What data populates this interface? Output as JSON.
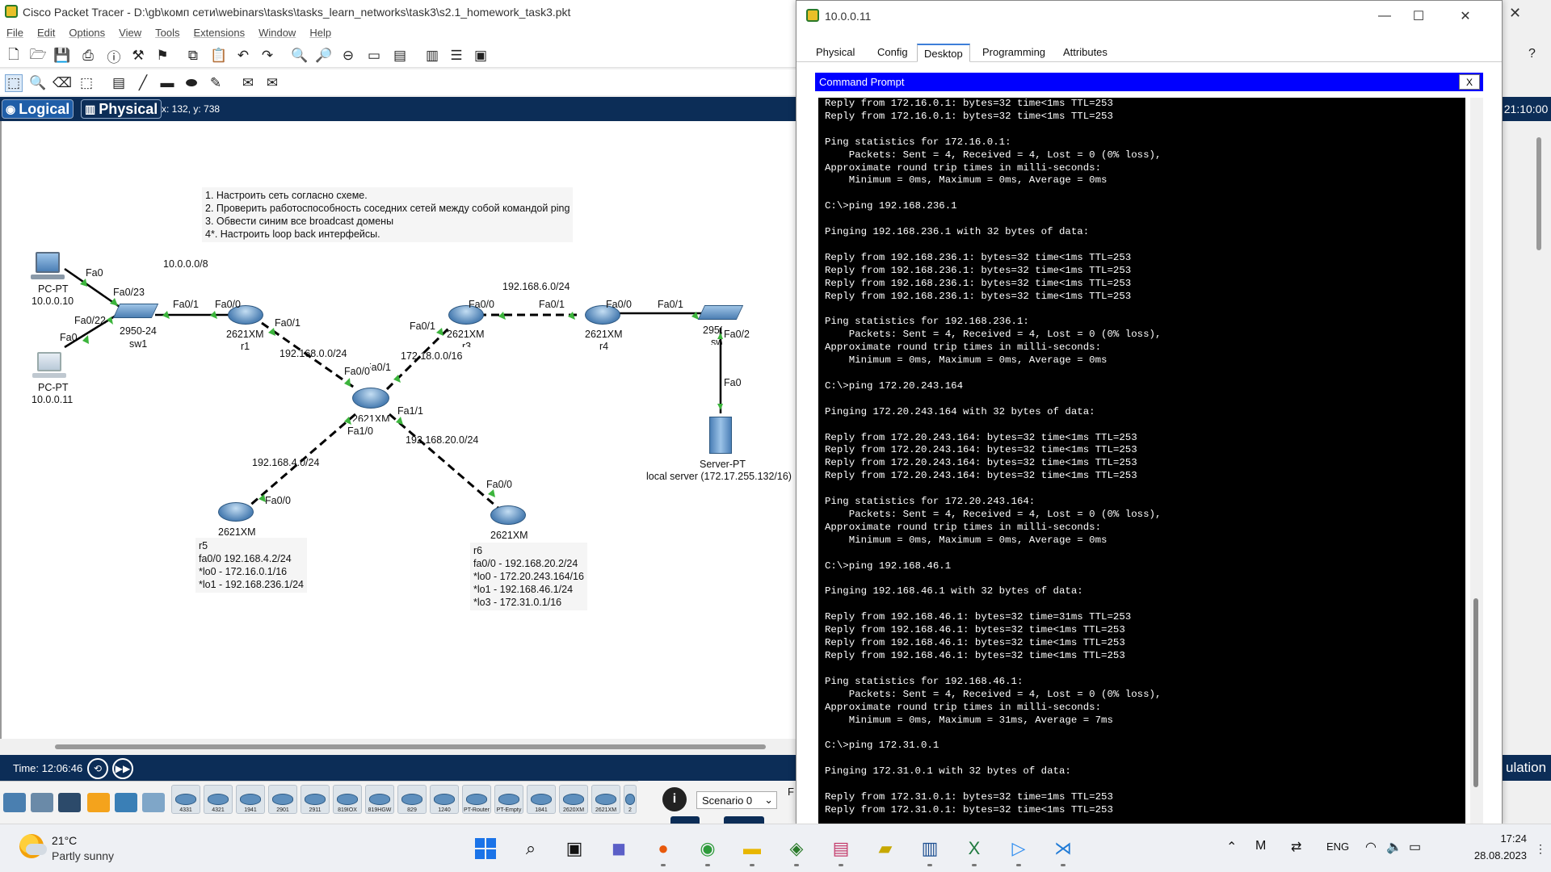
{
  "app": {
    "title": "Cisco Packet Tracer - D:\\gb\\комп сети\\webinars\\tasks\\tasks_learn_networks\\task3\\s2.1_homework_task3.pkt",
    "menu": [
      "File",
      "Edit",
      "Options",
      "View",
      "Tools",
      "Extensions",
      "Window",
      "Help"
    ],
    "view_logical": "Logical",
    "view_physical": "Physical",
    "coords": "x: 132, y: 738",
    "clock_right": "21:10:00",
    "sim_label": "ulation",
    "time_label": "Time: 12:06:46",
    "scenario": "Scenario 0",
    "scenario_frag": "F"
  },
  "notes": {
    "task": [
      "1. Настроить сеть согласно схеме.",
      "2. Проверить работоспособность соседних сетей между собой командой ping",
      "3. Обвести синим все broadcast домены",
      "4*. Настроить loop back интерфейсы."
    ],
    "r5": [
      "r5",
      "fa0/0 192.168.4.2/24",
      "*lo0 - 172.16.0.1/16",
      "*lo1 - 192.168.236.1/24"
    ],
    "r6": [
      "r6",
      "fa0/0 - 192.168.20.2/24",
      "*lo0 - 172.20.243.164/16",
      "*lo1 - 192.168.46.1/24",
      "*lo3 - 172.31.0.1/16"
    ]
  },
  "topology": {
    "labels": {
      "net_10": "10.0.0.0/8",
      "net_168_0": "192.168.0.0/24",
      "net_172_18": "172.18.0.0/16",
      "net_168_6": "192.168.6.0/24",
      "net_168_4": "192.168.4.0/24",
      "net_168_20": "192.168.20.0/24",
      "pc0_port": "Fa0",
      "pc0_name": "PC-PT",
      "pc0_ip": "10.0.0.10",
      "pc1_port": "Fa0",
      "pc1_name": "PC-PT",
      "pc1_ip": "10.0.0.11",
      "sw1_fa023": "Fa0/23",
      "sw1_fa022": "Fa0/22",
      "sw1_fa01": "Fa0/1",
      "sw1_model": "2950-24",
      "sw1_name": "sw1",
      "r1_fa00": "Fa0/0",
      "r1_fa01": "Fa0/1",
      "r1_model": "2621XM",
      "r1_name": "r1",
      "rc_fa00": "Fa0/0",
      "rc_fa01_frag": "Fa0/1",
      "rc_fa11": "Fa1/1",
      "rc_fa10": "Fa1/0",
      "rc_model": "2621XM",
      "r3_fa01": "Fa0/1",
      "r3_fa00": "Fa0/0",
      "r3_model": "2621XM",
      "r3_name": "r3",
      "r4_fa01": "Fa0/1",
      "r4_fa00": "Fa0/0",
      "r4_model": "2621XM",
      "r4_name": "r4",
      "sw2_fa01": "Fa0/1",
      "sw2_fa02": "Fa0/2",
      "sw2_model": "2950",
      "sw2_name": "sw2",
      "srv_fa0": "Fa0",
      "srv_name": "Server-PT",
      "srv_desc": "local server (172.17.255.132/16)",
      "r5_fa00": "Fa0/0",
      "r5_model": "2621XM",
      "r6_fa00": "Fa0/0",
      "r6_model": "2621XM"
    }
  },
  "devices_bar": [
    "4331",
    "4321",
    "1941",
    "2901",
    "2911",
    "819IOX",
    "819HGW",
    "829",
    "1240",
    "PT-Router",
    "PT-Empty",
    "1841",
    "2620XM",
    "2621XM",
    "2"
  ],
  "pc_window": {
    "title": "10.0.0.11",
    "tabs": [
      "Physical",
      "Config",
      "Desktop",
      "Programming",
      "Attributes"
    ],
    "active_tab": "Desktop",
    "cmd_title": "Command Prompt",
    "cmd_close": "X",
    "terminal_lines": [
      "Reply from 172.16.0.1: bytes=32 time<1ms TTL=253",
      "Reply from 172.16.0.1: bytes=32 time<1ms TTL=253",
      "",
      "Ping statistics for 172.16.0.1:",
      "    Packets: Sent = 4, Received = 4, Lost = 0 (0% loss),",
      "Approximate round trip times in milli-seconds:",
      "    Minimum = 0ms, Maximum = 0ms, Average = 0ms",
      "",
      "C:\\>ping 192.168.236.1",
      "",
      "Pinging 192.168.236.1 with 32 bytes of data:",
      "",
      "Reply from 192.168.236.1: bytes=32 time<1ms TTL=253",
      "Reply from 192.168.236.1: bytes=32 time<1ms TTL=253",
      "Reply from 192.168.236.1: bytes=32 time<1ms TTL=253",
      "Reply from 192.168.236.1: bytes=32 time<1ms TTL=253",
      "",
      "Ping statistics for 192.168.236.1:",
      "    Packets: Sent = 4, Received = 4, Lost = 0 (0% loss),",
      "Approximate round trip times in milli-seconds:",
      "    Minimum = 0ms, Maximum = 0ms, Average = 0ms",
      "",
      "C:\\>ping 172.20.243.164",
      "",
      "Pinging 172.20.243.164 with 32 bytes of data:",
      "",
      "Reply from 172.20.243.164: bytes=32 time<1ms TTL=253",
      "Reply from 172.20.243.164: bytes=32 time<1ms TTL=253",
      "Reply from 172.20.243.164: bytes=32 time<1ms TTL=253",
      "Reply from 172.20.243.164: bytes=32 time<1ms TTL=253",
      "",
      "Ping statistics for 172.20.243.164:",
      "    Packets: Sent = 4, Received = 4, Lost = 0 (0% loss),",
      "Approximate round trip times in milli-seconds:",
      "    Minimum = 0ms, Maximum = 0ms, Average = 0ms",
      "",
      "C:\\>ping 192.168.46.1",
      "",
      "Pinging 192.168.46.1 with 32 bytes of data:",
      "",
      "Reply from 192.168.46.1: bytes=32 time=31ms TTL=253",
      "Reply from 192.168.46.1: bytes=32 time<1ms TTL=253",
      "Reply from 192.168.46.1: bytes=32 time<1ms TTL=253",
      "Reply from 192.168.46.1: bytes=32 time<1ms TTL=253",
      "",
      "Ping statistics for 192.168.46.1:",
      "    Packets: Sent = 4, Received = 4, Lost = 0 (0% loss),",
      "Approximate round trip times in milli-seconds:",
      "    Minimum = 0ms, Maximum = 31ms, Average = 7ms",
      "",
      "C:\\>ping 172.31.0.1",
      "",
      "Pinging 172.31.0.1 with 32 bytes of data:",
      "",
      "Reply from 172.31.0.1: bytes=32 time=1ms TTL=253",
      "Reply from 172.31.0.1: bytes=32 time<1ms TTL=253"
    ]
  },
  "taskbar": {
    "temperature": "21°C",
    "condition": "Partly sunny",
    "lang": "ENG",
    "time": "17:24",
    "date": "28.08.2023"
  },
  "colors": {
    "pt_navy": "#0c2d57",
    "cmd_blue": "#0000ff",
    "link_green": "#3cb43c"
  }
}
